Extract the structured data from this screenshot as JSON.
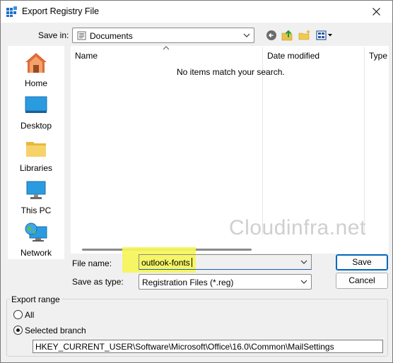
{
  "window": {
    "title": "Export Registry File"
  },
  "save_in": {
    "label": "Save in:",
    "value": "Documents"
  },
  "places": [
    {
      "label": "Home",
      "icon": "home-icon"
    },
    {
      "label": "Desktop",
      "icon": "desktop-icon"
    },
    {
      "label": "Libraries",
      "icon": "libraries-icon"
    },
    {
      "label": "This PC",
      "icon": "this-pc-icon"
    },
    {
      "label": "Network",
      "icon": "network-icon"
    }
  ],
  "file_list": {
    "columns": [
      "Name",
      "Date modified",
      "Type"
    ],
    "empty_message": "No items match your search."
  },
  "file_name": {
    "label": "File name:",
    "value": "outlook-fonts"
  },
  "save_as_type": {
    "label": "Save as type:",
    "value": "Registration Files (*.reg)"
  },
  "buttons": {
    "save": "Save",
    "cancel": "Cancel"
  },
  "export_range": {
    "title": "Export range",
    "option_all": "All",
    "option_selected": "Selected branch",
    "selected": "Selected branch",
    "branch_path": "HKEY_CURRENT_USER\\Software\\Microsoft\\Office\\16.0\\Common\\MailSettings"
  },
  "watermark": "Cloudinfra.net",
  "colors": {
    "highlight": "#f6f55a",
    "accent": "#0067c0"
  }
}
